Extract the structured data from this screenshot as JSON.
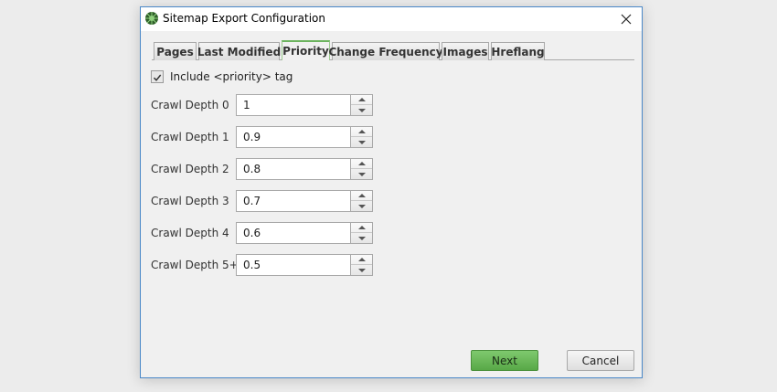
{
  "window": {
    "title": "Sitemap Export Configuration"
  },
  "tabs": [
    {
      "label": "Pages",
      "active": false
    },
    {
      "label": "Last Modified",
      "active": false
    },
    {
      "label": "Priority",
      "active": true
    },
    {
      "label": "Change Frequency",
      "active": false
    },
    {
      "label": "Images",
      "active": false
    },
    {
      "label": "Hreflang",
      "active": false
    }
  ],
  "include_priority": {
    "label": "Include <priority> tag",
    "checked": true
  },
  "crawl_depths": [
    {
      "label": "Crawl Depth 0",
      "value": "1"
    },
    {
      "label": "Crawl Depth 1",
      "value": "0.9"
    },
    {
      "label": "Crawl Depth 2",
      "value": "0.8"
    },
    {
      "label": "Crawl Depth 3",
      "value": "0.7"
    },
    {
      "label": "Crawl Depth 4",
      "value": "0.6"
    },
    {
      "label": "Crawl Depth 5+",
      "value": "0.5"
    }
  ],
  "buttons": {
    "next": "Next",
    "cancel": "Cancel"
  },
  "colors": {
    "accent_green": "#6cb35e",
    "window_border": "#4a88c8"
  },
  "icons": {
    "app": "spider-icon",
    "close": "close-icon",
    "check": "checkmark-icon",
    "spin_up": "spin-up-arrow-icon",
    "spin_down": "spin-down-arrow-icon"
  }
}
